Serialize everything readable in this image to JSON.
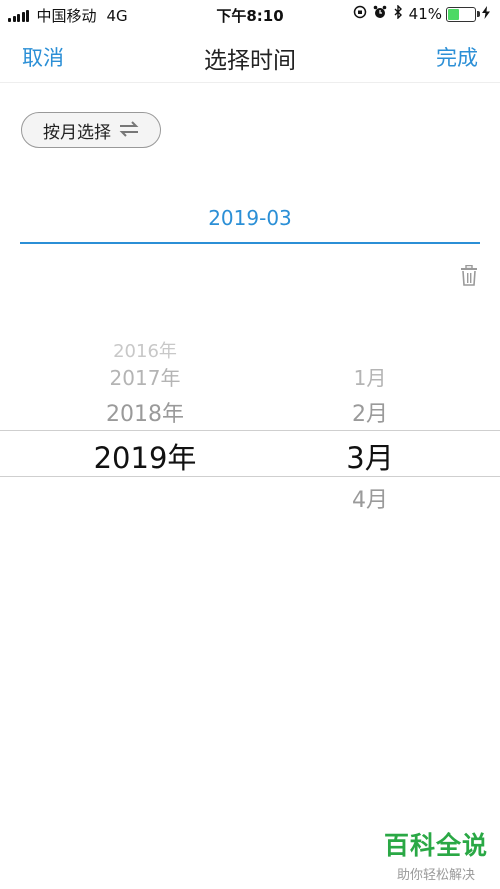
{
  "status_bar": {
    "carrier": "中国移动",
    "network": "4G",
    "time": "下午8:10",
    "battery_percent": "41%",
    "battery_level": 0.41,
    "battery_color": "#4cd964"
  },
  "nav": {
    "cancel_label": "取消",
    "title": "选择时间",
    "done_label": "完成",
    "accent_color": "#2b8fd6"
  },
  "mode_toggle": {
    "label": "按月选择",
    "icon": "swap-arrows-icon"
  },
  "date_field": {
    "value": "2019-03"
  },
  "picker": {
    "year_column": [
      "2016年",
      "2017年",
      "2018年",
      "2019年"
    ],
    "selected_year": "2019年",
    "month_column": [
      "1月",
      "2月",
      "3月",
      "4月"
    ],
    "selected_month": "3月"
  },
  "watermark": {
    "main": "百科全说",
    "sub": "助你轻松解决"
  }
}
